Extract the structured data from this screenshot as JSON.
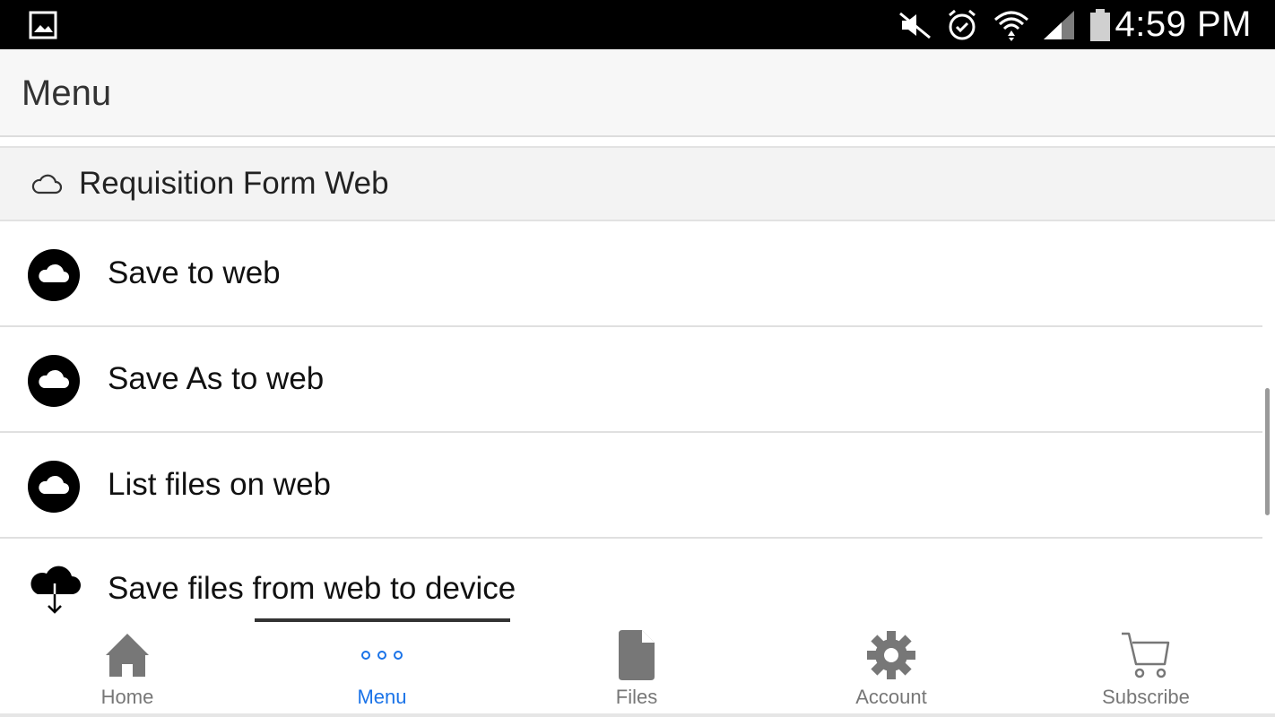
{
  "status_bar": {
    "time": "4:59 PM",
    "icons": [
      "gallery-icon",
      "mute-icon",
      "alarm-icon",
      "wifi-icon",
      "signal-icon",
      "battery-icon"
    ]
  },
  "app_bar": {
    "title": "Menu"
  },
  "section": {
    "title": "Requisition Form Web",
    "icon": "cloud-outline-icon"
  },
  "menu": {
    "items": [
      {
        "label": "Save to web",
        "icon": "cloud-icon"
      },
      {
        "label": "Save As to web",
        "icon": "cloud-icon"
      },
      {
        "label": "List files on web",
        "icon": "cloud-icon"
      },
      {
        "label": "Save files from web to device",
        "icon": "cloud-download-icon"
      }
    ]
  },
  "bottom_nav": {
    "active_index": 1,
    "active_color": "#1a73e8",
    "inactive_color": "#777777",
    "items": [
      {
        "label": "Home",
        "icon": "home-icon"
      },
      {
        "label": "Menu",
        "icon": "more-dots-icon"
      },
      {
        "label": "Files",
        "icon": "file-icon"
      },
      {
        "label": "Account",
        "icon": "gear-icon"
      },
      {
        "label": "Subscribe",
        "icon": "cart-icon"
      }
    ]
  }
}
